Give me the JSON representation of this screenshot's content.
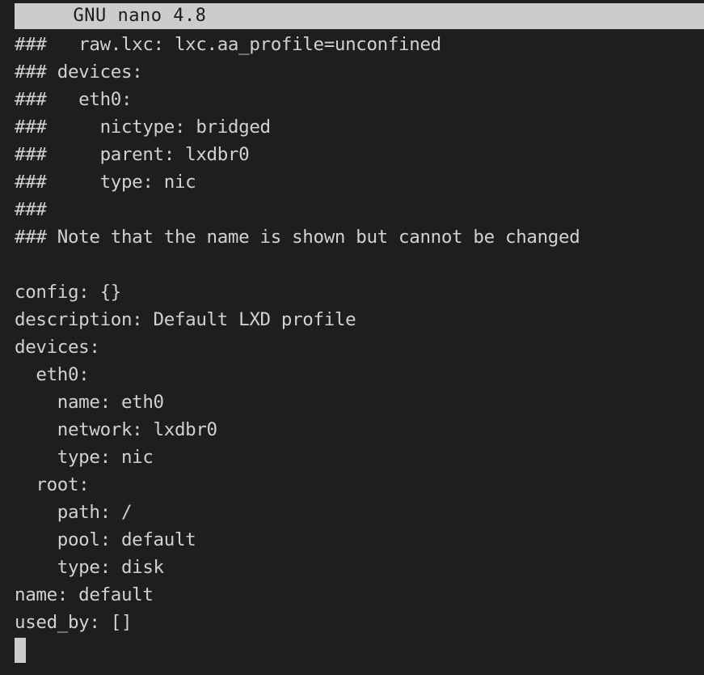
{
  "app": {
    "name": "GNU nano",
    "version": "4.8",
    "title": "  GNU nano 4.8",
    "background_color": "#1e1e1e",
    "text_color": "#d4d0cb",
    "titlebar_background": "#cccccc",
    "titlebar_text_color": "#1c1c1c",
    "cursor_color": "#cccccc"
  },
  "buffer": {
    "lines": [
      "###   raw.lxc: lxc.aa_profile=unconfined",
      "### devices:",
      "###   eth0:",
      "###     nictype: bridged",
      "###     parent: lxdbr0",
      "###     type: nic",
      "###",
      "### Note that the name is shown but cannot be changed",
      "",
      "config: {}",
      "description: Default LXD profile",
      "devices:",
      "  eth0:",
      "    name: eth0",
      "    network: lxdbr0",
      "    type: nic",
      "  root:",
      "    path: /",
      "    pool: default",
      "    type: disk",
      "name: default",
      "used_by: []"
    ]
  },
  "cursor": {
    "row": 22,
    "column": 0
  }
}
